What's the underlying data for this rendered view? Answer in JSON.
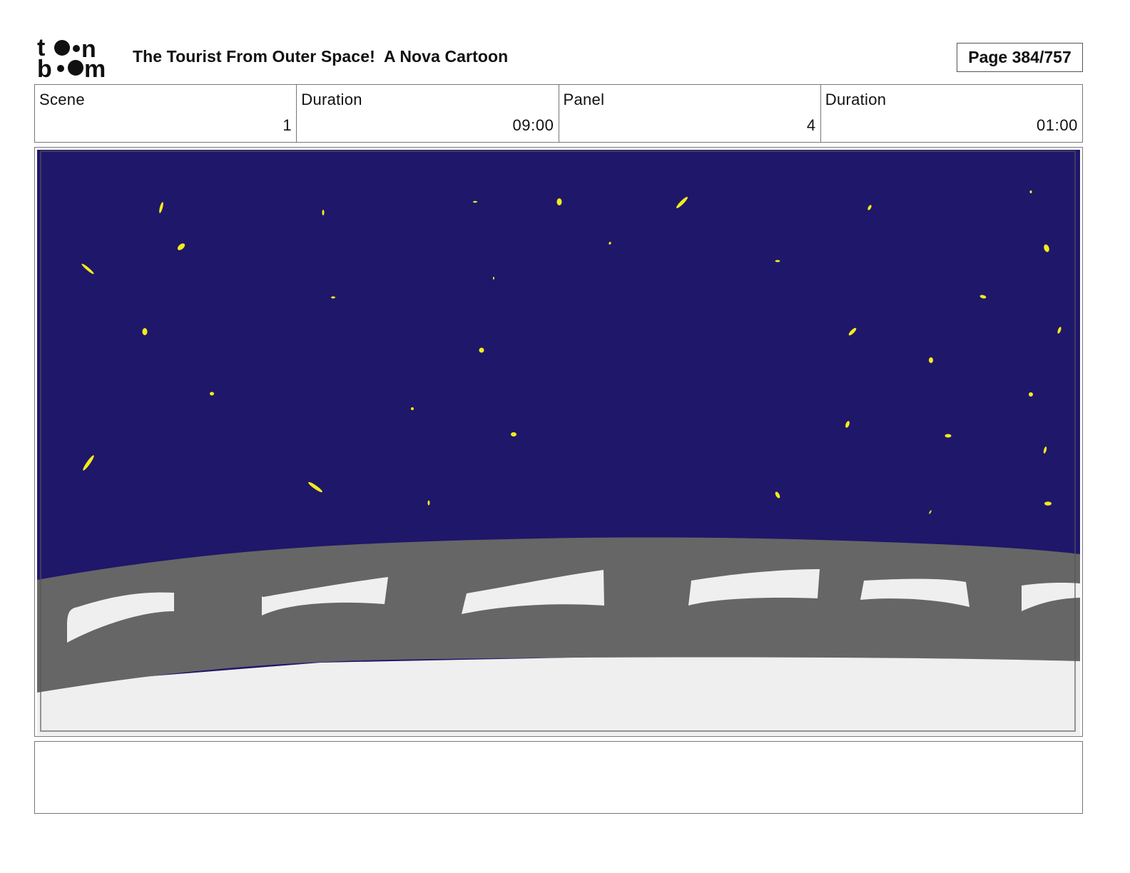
{
  "header": {
    "logo_text_top": "toon",
    "logo_text_bottom": "boom",
    "logo_icon": "toonboom-logo",
    "title": "The Tourist From Outer Space!  A Nova Cartoon",
    "page_label": "Page 384/757"
  },
  "info": [
    {
      "label": "Scene",
      "value": "1"
    },
    {
      "label": "Duration",
      "value": "09:00"
    },
    {
      "label": "Panel",
      "value": "4"
    },
    {
      "label": "Duration",
      "value": "01:00"
    }
  ],
  "panel": {
    "sky_color": "#1f176a",
    "star_color": "#f4ec1a",
    "railing_color": "#666666",
    "window_color": "#efefef",
    "ground_color": "#efefef"
  },
  "notes": {
    "text": ""
  }
}
